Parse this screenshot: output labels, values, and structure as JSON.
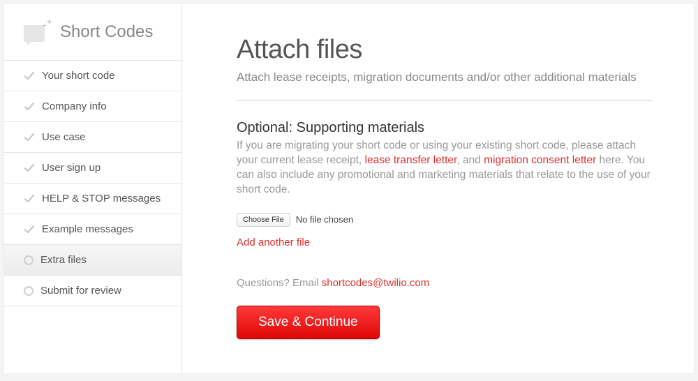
{
  "sidebar": {
    "title": "Short Codes",
    "items": [
      {
        "label": "Your short code",
        "state": "done"
      },
      {
        "label": "Company info",
        "state": "done"
      },
      {
        "label": "Use case",
        "state": "done"
      },
      {
        "label": "User sign up",
        "state": "done"
      },
      {
        "label": "HELP & STOP messages",
        "state": "done"
      },
      {
        "label": "Example messages",
        "state": "done"
      },
      {
        "label": "Extra files",
        "state": "active"
      },
      {
        "label": "Submit for review",
        "state": "pending"
      }
    ]
  },
  "main": {
    "title": "Attach files",
    "subtitle": "Attach lease receipts, migration documents and/or other additional materials",
    "section_title": "Optional: Supporting materials",
    "para_1": "If you are migrating your short code or using your existing short code, please attach your current lease receipt, ",
    "link_1": "lease transfer letter",
    "para_2": ", and ",
    "link_2": "migration consent letter",
    "para_3": " here. You can also include any promotional and marketing materials that relate to the use of your short code.",
    "choose_file_label": "Choose File",
    "file_status": "No file chosen",
    "add_another": "Add another file",
    "questions_prefix": "Questions? Email ",
    "questions_email": "shortcodes@twilio.com",
    "save_button": "Save & Continue"
  }
}
